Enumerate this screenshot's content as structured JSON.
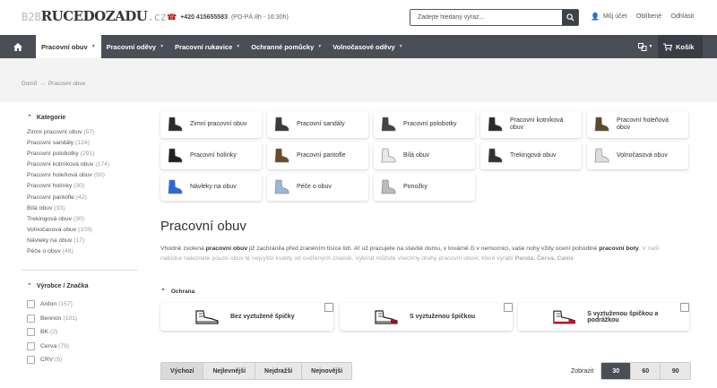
{
  "header": {
    "logo_b2b": "B2B",
    "logo_brand": "RUCEDOZADU",
    "logo_tld": ".cz",
    "phone": "+420 415655583",
    "hours": "(PO-PÁ 8h - 16:30h)",
    "search_placeholder": "Zadejte hledaný výraz...",
    "account": "Můj účet",
    "favorites": "Oblíbené",
    "logout": "Odhlásit"
  },
  "nav": {
    "items": [
      {
        "label": "Pracovní obuv",
        "active": true
      },
      {
        "label": "Pracovní oděvy"
      },
      {
        "label": "Pracovní rukavice"
      },
      {
        "label": "Ochranné pomůcky"
      },
      {
        "label": "Volnočasové oděvy"
      }
    ],
    "cart": "Košík"
  },
  "breadcrumb": {
    "home": "Domů",
    "separator": "→",
    "current": "Pracovní obuv"
  },
  "sidebar": {
    "categories_title": "Kategorie",
    "categories": [
      {
        "label": "Zimní pracovní obuv",
        "count": "(57)"
      },
      {
        "label": "Pracovní sandály",
        "count": "(124)"
      },
      {
        "label": "Pracovní polobotky",
        "count": "(291)"
      },
      {
        "label": "Pracovní kotníková obuv",
        "count": "(174)"
      },
      {
        "label": "Pracovní holeňová obuv",
        "count": "(50)"
      },
      {
        "label": "Pracovní holínky",
        "count": "(30)"
      },
      {
        "label": "Pracovní pantofle",
        "count": "(42)"
      },
      {
        "label": "Bílá obuv",
        "count": "(33)"
      },
      {
        "label": "Trekingová obuv",
        "count": "(30)"
      },
      {
        "label": "Volnočasová obuv",
        "count": "(103)"
      },
      {
        "label": "Návleky na obuv",
        "count": "(17)"
      },
      {
        "label": "Péče o obuv",
        "count": "(48)"
      }
    ],
    "brands_title": "Výrobce / Značka",
    "brands": [
      {
        "label": "Ardon",
        "count": "(157)"
      },
      {
        "label": "Bennon",
        "count": "(101)"
      },
      {
        "label": "BK",
        "count": "(2)"
      },
      {
        "label": "Cerva",
        "count": "(79)"
      },
      {
        "label": "CRV",
        "count": "(5)"
      }
    ]
  },
  "tiles": [
    {
      "label": "Zimní pracovní obuv",
      "icon": "winter-boot-icon",
      "color": "#2b2b2b"
    },
    {
      "label": "Pracovní sandály",
      "icon": "sandal-icon",
      "color": "#3a3a3a"
    },
    {
      "label": "Pracovní polobotky",
      "icon": "low-shoe-icon",
      "color": "#444"
    },
    {
      "label": "Pracovní kotníková obuv",
      "icon": "ankle-boot-icon",
      "color": "#2a2a2a"
    },
    {
      "label": "Pracovní holeňová obuv",
      "icon": "high-boot-icon",
      "color": "#5a4a2a"
    },
    {
      "label": "Pracovní holínky",
      "icon": "rubber-boot-icon",
      "color": "#222"
    },
    {
      "label": "Pracovní pantofle",
      "icon": "clog-icon",
      "color": "#6a4a2a"
    },
    {
      "label": "Bílá obuv",
      "icon": "white-shoe-icon",
      "color": "#e8e8e8"
    },
    {
      "label": "Trekingová obuv",
      "icon": "trekking-shoe-icon",
      "color": "#333"
    },
    {
      "label": "Volnočasová obuv",
      "icon": "sneaker-icon",
      "color": "#ddd"
    },
    {
      "label": "Návleky na obuv",
      "icon": "shoe-cover-icon",
      "color": "#2a6ad8"
    },
    {
      "label": "Péče o obuv",
      "icon": "shoe-care-icon",
      "color": "#9ab8d8"
    },
    {
      "label": "Ponožky",
      "icon": "sock-icon",
      "color": "#bbb"
    }
  ],
  "main": {
    "title": "Pracovní obuv",
    "desc_p1": "Vhodně zvolená ",
    "desc_b1": "pracovní obuv",
    "desc_p2": " již zachránila před zraněním tisíce lidí. Ať už pracujete na stavbě domu, v továrně či v nemocnici, vaše nohy vždy ocení pohodlné ",
    "desc_b2": "pracovní boty",
    "desc_p3": ". V naší nabídce naleznete pouze obuv té nejvyšší kvality od ověřených značek. Vybírat můžete všechny druhy pracovní obuvi, které vyrábí ",
    "desc_b3": "Panda, Červa, Canis"
  },
  "filter": {
    "title": "Ochrana",
    "options": [
      {
        "label": "Bez vyztužené špičky"
      },
      {
        "label": "S vyztuženou špičkou"
      },
      {
        "label": "S vyztuženou špičkou a podrážkou"
      }
    ]
  },
  "sort": {
    "options": [
      "Výchozí",
      "Nejlevnější",
      "Nejdražší",
      "Nejnovější"
    ],
    "per_page_label": "Zobrazit",
    "per_page": [
      "30",
      "60",
      "90"
    ]
  }
}
